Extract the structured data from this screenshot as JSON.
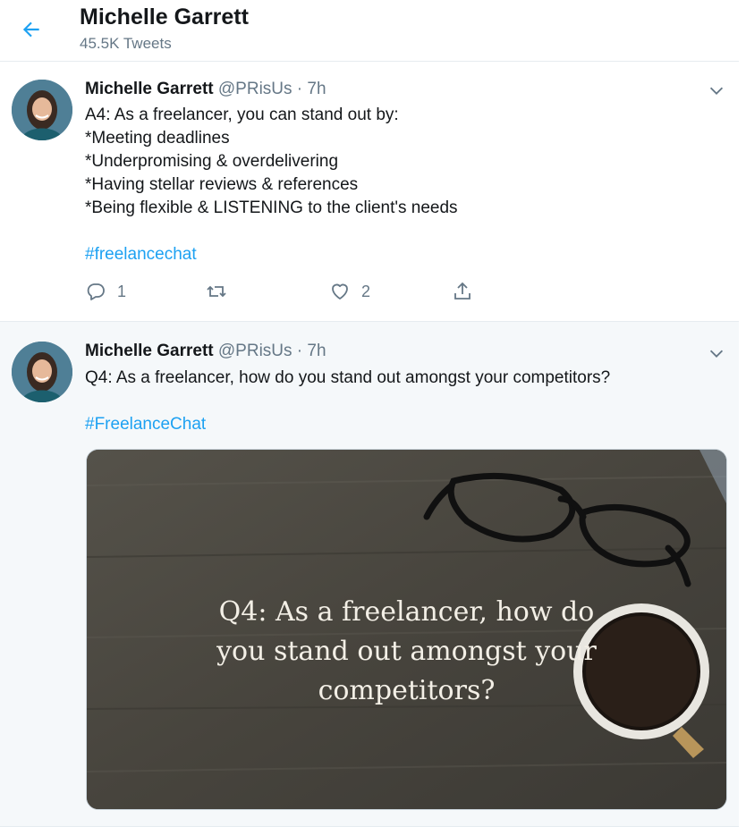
{
  "header": {
    "name": "Michelle Garrett",
    "tweet_count": "45.5K Tweets"
  },
  "colors": {
    "accent": "#1da1f2",
    "secondary_text": "#657786",
    "border": "#e6ecf0"
  },
  "tweets": [
    {
      "name": "Michelle Garrett",
      "handle": "@PRisUs",
      "dot": "·",
      "time": "7h",
      "lines": [
        "A4: As a freelancer, you can stand out by:",
        "*Meeting deadlines",
        "*Underpromising & overdelivering",
        "*Having stellar reviews & references",
        "*Being flexible & LISTENING to the client's needs"
      ],
      "hashtag": "#freelancechat",
      "reply_count": "1",
      "like_count": "2"
    },
    {
      "name": "Michelle Garrett",
      "handle": "@PRisUs",
      "dot": "·",
      "time": "7h",
      "lines": [
        "Q4: As a freelancer, how do you stand out amongst your competitors?"
      ],
      "hashtag": "#FreelanceChat",
      "media_caption": [
        "Q4: As a freelancer, how do",
        "you stand out amongst your",
        "competitors?"
      ]
    }
  ],
  "icons": {
    "back": "back-arrow-icon",
    "chevron": "chevron-down-icon",
    "reply": "reply-icon",
    "retweet": "retweet-icon",
    "like": "heart-icon",
    "share": "share-icon"
  }
}
